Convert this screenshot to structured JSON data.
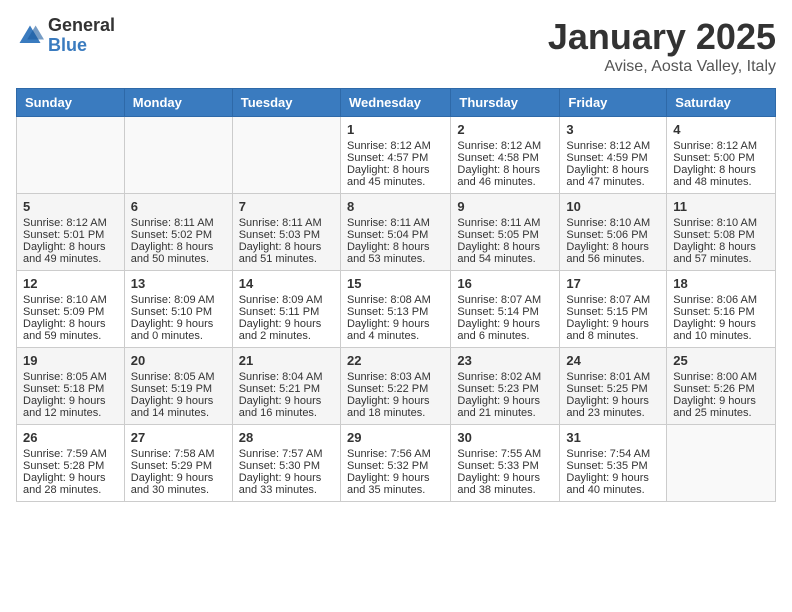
{
  "logo": {
    "general": "General",
    "blue": "Blue"
  },
  "title": "January 2025",
  "location": "Avise, Aosta Valley, Italy",
  "days_of_week": [
    "Sunday",
    "Monday",
    "Tuesday",
    "Wednesday",
    "Thursday",
    "Friday",
    "Saturday"
  ],
  "weeks": [
    [
      {
        "day": "",
        "data": ""
      },
      {
        "day": "",
        "data": ""
      },
      {
        "day": "",
        "data": ""
      },
      {
        "day": "1",
        "data": "Sunrise: 8:12 AM\nSunset: 4:57 PM\nDaylight: 8 hours\nand 45 minutes."
      },
      {
        "day": "2",
        "data": "Sunrise: 8:12 AM\nSunset: 4:58 PM\nDaylight: 8 hours\nand 46 minutes."
      },
      {
        "day": "3",
        "data": "Sunrise: 8:12 AM\nSunset: 4:59 PM\nDaylight: 8 hours\nand 47 minutes."
      },
      {
        "day": "4",
        "data": "Sunrise: 8:12 AM\nSunset: 5:00 PM\nDaylight: 8 hours\nand 48 minutes."
      }
    ],
    [
      {
        "day": "5",
        "data": "Sunrise: 8:12 AM\nSunset: 5:01 PM\nDaylight: 8 hours\nand 49 minutes."
      },
      {
        "day": "6",
        "data": "Sunrise: 8:11 AM\nSunset: 5:02 PM\nDaylight: 8 hours\nand 50 minutes."
      },
      {
        "day": "7",
        "data": "Sunrise: 8:11 AM\nSunset: 5:03 PM\nDaylight: 8 hours\nand 51 minutes."
      },
      {
        "day": "8",
        "data": "Sunrise: 8:11 AM\nSunset: 5:04 PM\nDaylight: 8 hours\nand 53 minutes."
      },
      {
        "day": "9",
        "data": "Sunrise: 8:11 AM\nSunset: 5:05 PM\nDaylight: 8 hours\nand 54 minutes."
      },
      {
        "day": "10",
        "data": "Sunrise: 8:10 AM\nSunset: 5:06 PM\nDaylight: 8 hours\nand 56 minutes."
      },
      {
        "day": "11",
        "data": "Sunrise: 8:10 AM\nSunset: 5:08 PM\nDaylight: 8 hours\nand 57 minutes."
      }
    ],
    [
      {
        "day": "12",
        "data": "Sunrise: 8:10 AM\nSunset: 5:09 PM\nDaylight: 8 hours\nand 59 minutes."
      },
      {
        "day": "13",
        "data": "Sunrise: 8:09 AM\nSunset: 5:10 PM\nDaylight: 9 hours\nand 0 minutes."
      },
      {
        "day": "14",
        "data": "Sunrise: 8:09 AM\nSunset: 5:11 PM\nDaylight: 9 hours\nand 2 minutes."
      },
      {
        "day": "15",
        "data": "Sunrise: 8:08 AM\nSunset: 5:13 PM\nDaylight: 9 hours\nand 4 minutes."
      },
      {
        "day": "16",
        "data": "Sunrise: 8:07 AM\nSunset: 5:14 PM\nDaylight: 9 hours\nand 6 minutes."
      },
      {
        "day": "17",
        "data": "Sunrise: 8:07 AM\nSunset: 5:15 PM\nDaylight: 9 hours\nand 8 minutes."
      },
      {
        "day": "18",
        "data": "Sunrise: 8:06 AM\nSunset: 5:16 PM\nDaylight: 9 hours\nand 10 minutes."
      }
    ],
    [
      {
        "day": "19",
        "data": "Sunrise: 8:05 AM\nSunset: 5:18 PM\nDaylight: 9 hours\nand 12 minutes."
      },
      {
        "day": "20",
        "data": "Sunrise: 8:05 AM\nSunset: 5:19 PM\nDaylight: 9 hours\nand 14 minutes."
      },
      {
        "day": "21",
        "data": "Sunrise: 8:04 AM\nSunset: 5:21 PM\nDaylight: 9 hours\nand 16 minutes."
      },
      {
        "day": "22",
        "data": "Sunrise: 8:03 AM\nSunset: 5:22 PM\nDaylight: 9 hours\nand 18 minutes."
      },
      {
        "day": "23",
        "data": "Sunrise: 8:02 AM\nSunset: 5:23 PM\nDaylight: 9 hours\nand 21 minutes."
      },
      {
        "day": "24",
        "data": "Sunrise: 8:01 AM\nSunset: 5:25 PM\nDaylight: 9 hours\nand 23 minutes."
      },
      {
        "day": "25",
        "data": "Sunrise: 8:00 AM\nSunset: 5:26 PM\nDaylight: 9 hours\nand 25 minutes."
      }
    ],
    [
      {
        "day": "26",
        "data": "Sunrise: 7:59 AM\nSunset: 5:28 PM\nDaylight: 9 hours\nand 28 minutes."
      },
      {
        "day": "27",
        "data": "Sunrise: 7:58 AM\nSunset: 5:29 PM\nDaylight: 9 hours\nand 30 minutes."
      },
      {
        "day": "28",
        "data": "Sunrise: 7:57 AM\nSunset: 5:30 PM\nDaylight: 9 hours\nand 33 minutes."
      },
      {
        "day": "29",
        "data": "Sunrise: 7:56 AM\nSunset: 5:32 PM\nDaylight: 9 hours\nand 35 minutes."
      },
      {
        "day": "30",
        "data": "Sunrise: 7:55 AM\nSunset: 5:33 PM\nDaylight: 9 hours\nand 38 minutes."
      },
      {
        "day": "31",
        "data": "Sunrise: 7:54 AM\nSunset: 5:35 PM\nDaylight: 9 hours\nand 40 minutes."
      },
      {
        "day": "",
        "data": ""
      }
    ]
  ]
}
